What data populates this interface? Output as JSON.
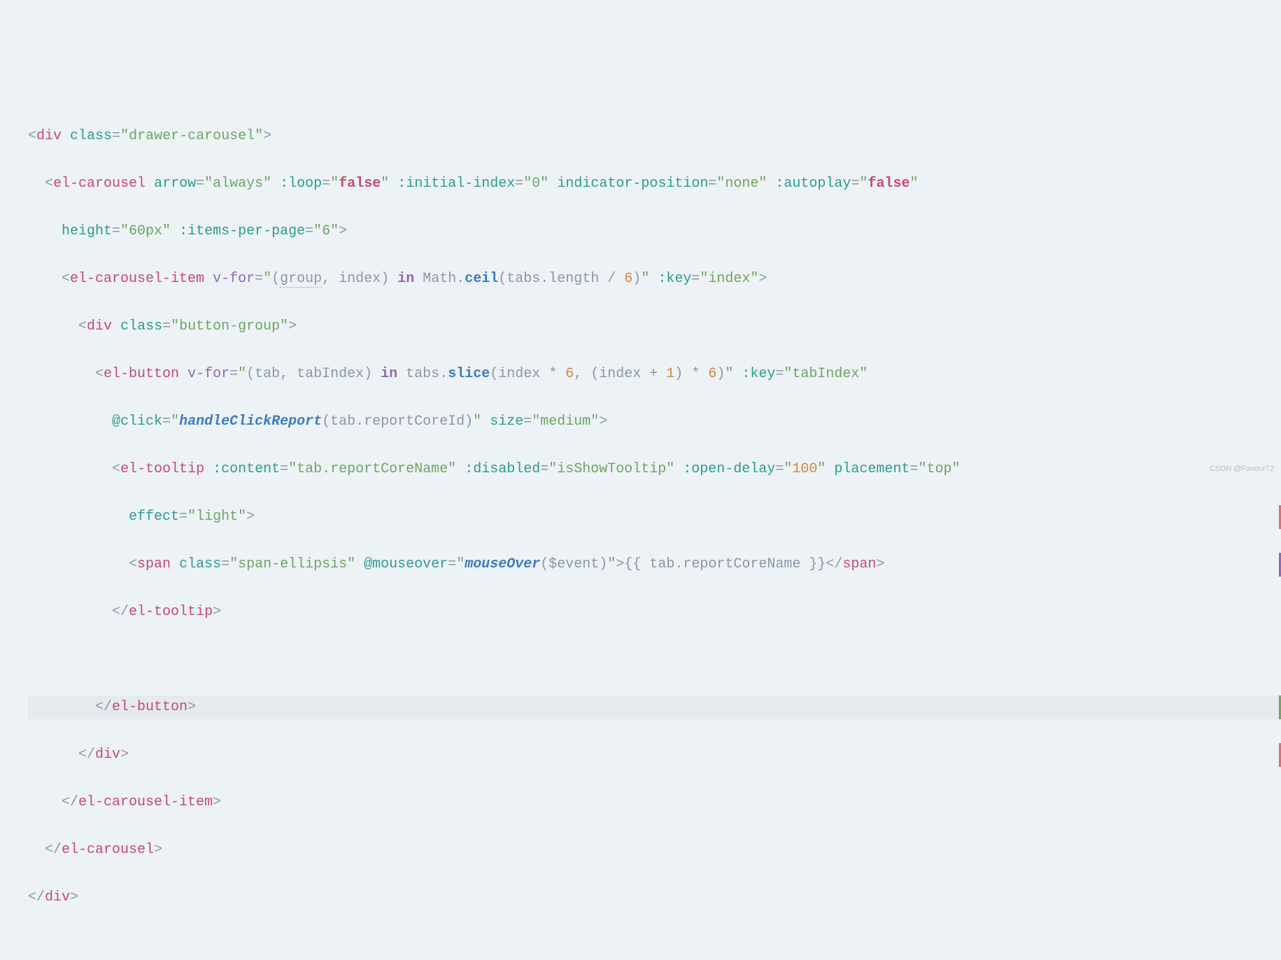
{
  "code": {
    "line1": {
      "tag_open": "<",
      "tag_name": "div",
      "attr1": "class",
      "eq": "=",
      "val1": "\"drawer-carousel\"",
      "tag_close": ">"
    },
    "line2": {
      "tag_open": "<",
      "tag_name": "el-carousel",
      "attr1": "arrow",
      "val1": "\"always\"",
      "attr2": ":loop",
      "val2_q": "\"",
      "val2_kw": "false",
      "attr3": ":initial-index",
      "val3": "\"0\"",
      "attr4": "indicator-position",
      "val4": "\"none\"",
      "attr5": ":autoplay",
      "val5_kw": "false"
    },
    "line3": {
      "attr1": "height",
      "val1": "\"60px\"",
      "attr2": ":items-per-page",
      "val2": "\"6\"",
      "tag_close": ">"
    },
    "line4": {
      "tag_open": "<",
      "tag_name": "el-carousel-item",
      "attr1": "v-for",
      "val_q": "\"",
      "val_p1": "(",
      "val_group": "group",
      "val_comma": ", ",
      "val_index": "index",
      "val_p2": ") ",
      "val_in": "in",
      "val_sp": " Math.",
      "val_ceil": "ceil",
      "val_p3": "(tabs.length / ",
      "val_6": "6",
      "val_p4": ")",
      "attr2": ":key",
      "val2": "\"index\"",
      "tag_close": ">"
    },
    "line5": {
      "tag_open": "<",
      "tag_name": "div",
      "attr1": "class",
      "val1": "\"button-group\"",
      "tag_close": ">"
    },
    "line6": {
      "tag_open": "<",
      "tag_name": "el-button",
      "attr1": "v-for",
      "val_q": "\"",
      "val_p1": "(tab, tabIndex) ",
      "val_in": "in",
      "val_sp": " tabs.",
      "val_slice": "slice",
      "val_p2": "(index * ",
      "val_6a": "6",
      "val_p3": ", (index + ",
      "val_1": "1",
      "val_p4": ") * ",
      "val_6b": "6",
      "val_p5": ")",
      "attr2": ":key",
      "val2": "\"tabIndex\""
    },
    "line7": {
      "attr1": "@click",
      "val_q": "\"",
      "val_fn": "handleClickReport",
      "val_p1": "(tab.reportCoreId)",
      "attr2": "size",
      "val2": "\"medium\"",
      "tag_close": ">"
    },
    "line8": {
      "tag_open": "<",
      "tag_name": "el-tooltip",
      "attr1": ":content",
      "val1": "\"tab.reportCoreName\"",
      "attr2": ":disabled",
      "val2": "\"isShowTooltip\"",
      "attr3": ":open-delay",
      "val3_q": "\"",
      "val3_n": "100",
      "attr4": "placement",
      "val4": "\"top\""
    },
    "line9": {
      "attr1": "effect",
      "val1": "\"light\"",
      "tag_close": ">"
    },
    "line10": {
      "tag_open": "<",
      "tag_name": "span",
      "attr1": "class",
      "val1": "\"span-ellipsis\"",
      "attr2": "@mouseover",
      "val_q": "\"",
      "val_fn": "mouseOver",
      "val_p": "($event)",
      "tag_close": ">",
      "mustache_o": "{{",
      "mustache_c": " tab.reportCoreName ",
      "mustache_e": "}}",
      "close_tag": "</",
      "close_name": "span",
      "close_end": ">"
    },
    "line11": {
      "close_tag": "</",
      "close_name": "el-tooltip",
      "close_end": ">"
    },
    "line12": {
      "close_tag": "</",
      "close_name": "el-button",
      "close_end": ">"
    },
    "line13": {
      "close_tag": "</",
      "close_name": "div",
      "close_end": ">"
    },
    "line14": {
      "close_tag": "</",
      "close_name": "el-carousel-item",
      "close_end": ">"
    },
    "line15": {
      "close_tag": "</",
      "close_name": "el-carousel",
      "close_end": ">"
    },
    "line16": {
      "close_tag": "</",
      "close_name": "div",
      "close_end": ">"
    }
  },
  "watermark": "CSDN @Favour72"
}
